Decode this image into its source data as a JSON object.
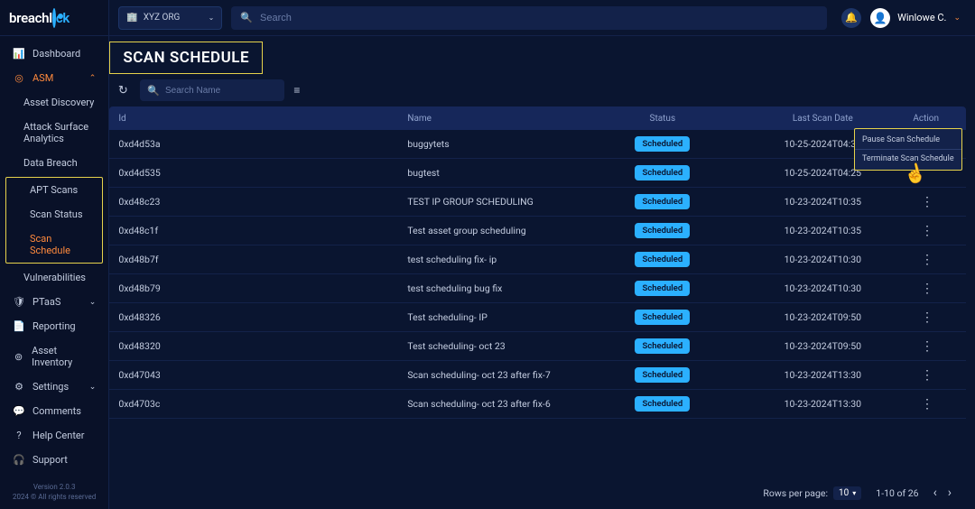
{
  "brand": {
    "name": "breachl",
    "suffix": "ck"
  },
  "org_selector": {
    "org_name": "XYZ ORG"
  },
  "global_search": {
    "placeholder": "Search"
  },
  "user": {
    "name": "Winlowe C."
  },
  "sidebar": {
    "items": [
      {
        "label": "Dashboard"
      },
      {
        "label": "ASM"
      },
      {
        "label": "Asset Discovery"
      },
      {
        "label": "Attack Surface Analytics"
      },
      {
        "label": "Data Breach"
      },
      {
        "label": "APT Scans"
      },
      {
        "label": "Scan Status"
      },
      {
        "label": "Scan Schedule"
      },
      {
        "label": "Vulnerabilities"
      },
      {
        "label": "PTaaS"
      },
      {
        "label": "Reporting"
      },
      {
        "label": "Asset Inventory"
      },
      {
        "label": "Settings"
      },
      {
        "label": "Comments"
      },
      {
        "label": "Help Center"
      },
      {
        "label": "Support"
      }
    ],
    "footer": {
      "version": "Version 2.0.3",
      "copyright": "2024 © All rights reserved"
    }
  },
  "page": {
    "title": "SCAN SCHEDULE",
    "search_placeholder": "Search Name"
  },
  "table": {
    "headers": {
      "id": "Id",
      "name": "Name",
      "status": "Status",
      "date": "Last Scan Date",
      "action": "Action"
    },
    "status_label": "Scheduled",
    "action_menu": {
      "pause": "Pause Scan Schedule",
      "terminate": "Terminate Scan Schedule"
    },
    "rows": [
      {
        "id": "0xd4d53a",
        "name": "buggytets",
        "date": "10-25-2024T04:30"
      },
      {
        "id": "0xd4d535",
        "name": "bugtest",
        "date": "10-25-2024T04:25"
      },
      {
        "id": "0xd48c23",
        "name": "TEST IP GROUP SCHEDULING",
        "date": "10-23-2024T10:35"
      },
      {
        "id": "0xd48c1f",
        "name": "Test asset group scheduling",
        "date": "10-23-2024T10:35"
      },
      {
        "id": "0xd48b7f",
        "name": "test scheduling fix- ip",
        "date": "10-23-2024T10:30"
      },
      {
        "id": "0xd48b79",
        "name": "test scheduling bug fix",
        "date": "10-23-2024T10:30"
      },
      {
        "id": "0xd48326",
        "name": "Test scheduling- IP",
        "date": "10-23-2024T09:50"
      },
      {
        "id": "0xd48320",
        "name": "Test scheduling- oct 23",
        "date": "10-23-2024T09:50"
      },
      {
        "id": "0xd47043",
        "name": "Scan scheduling- oct 23 after fix-7",
        "date": "10-23-2024T13:30"
      },
      {
        "id": "0xd4703c",
        "name": "Scan scheduling- oct 23 after fix-6",
        "date": "10-23-2024T13:30"
      }
    ]
  },
  "pagination": {
    "rows_per_page_label": "Rows per page:",
    "page_size": "10",
    "range": "1-10 of 26"
  }
}
